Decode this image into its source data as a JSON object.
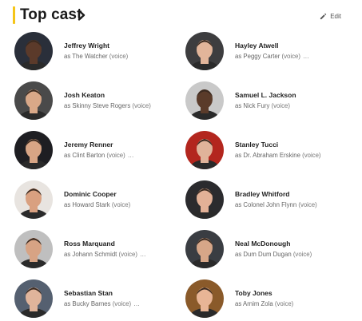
{
  "header": {
    "title": "Top cast",
    "edit_label": "Edit",
    "accent": "#f5c518"
  },
  "cast": [
    {
      "name": "Jeffrey Wright",
      "as": "as",
      "character": "The Watcher",
      "note": "(voice)",
      "more": false,
      "bg": "#2a2f3a",
      "skin": "#5b3a2a"
    },
    {
      "name": "Hayley Atwell",
      "as": "as",
      "character": "Peggy Carter",
      "note": "(voice)",
      "more": true,
      "bg": "#3d3d3f",
      "skin": "#e2b59a"
    },
    {
      "name": "Josh Keaton",
      "as": "as",
      "character": "Skinny Steve Rogers",
      "note": "(voice)",
      "more": false,
      "bg": "#4a4a4a",
      "skin": "#d9a888"
    },
    {
      "name": "Samuel L. Jackson",
      "as": "as",
      "character": "Nick Fury",
      "note": "(voice)",
      "more": false,
      "bg": "#c9c9c9",
      "skin": "#5a3b2a"
    },
    {
      "name": "Jeremy Renner",
      "as": "as",
      "character": "Clint Barton",
      "note": "(voice)",
      "more": true,
      "bg": "#1e1e22",
      "skin": "#d8a585"
    },
    {
      "name": "Stanley Tucci",
      "as": "as",
      "character": "Dr. Abraham Erskine",
      "note": "(voice)",
      "more": false,
      "bg": "#b3261e",
      "skin": "#e0b39a"
    },
    {
      "name": "Dominic Cooper",
      "as": "as",
      "character": "Howard Stark",
      "note": "(voice)",
      "more": false,
      "bg": "#e8e4e0",
      "skin": "#d9a080"
    },
    {
      "name": "Bradley Whitford",
      "as": "as",
      "character": "Colonel John Flynn",
      "note": "(voice)",
      "more": false,
      "bg": "#2b2b2e",
      "skin": "#e3b197"
    },
    {
      "name": "Ross Marquand",
      "as": "as",
      "character": "Johann Schmidt",
      "note": "(voice)",
      "more": true,
      "bg": "#bfbfbf",
      "skin": "#d7a384"
    },
    {
      "name": "Neal McDonough",
      "as": "as",
      "character": "Dum Dum Dugan",
      "note": "(voice)",
      "more": false,
      "bg": "#3a3d42",
      "skin": "#d6a688"
    },
    {
      "name": "Sebastian Stan",
      "as": "as",
      "character": "Bucky Barnes",
      "note": "(voice)",
      "more": true,
      "bg": "#556070",
      "skin": "#e0b49b"
    },
    {
      "name": "Toby Jones",
      "as": "as",
      "character": "Arnim Zola",
      "note": "(voice)",
      "more": false,
      "bg": "#8a5a2a",
      "skin": "#e8b596"
    }
  ]
}
